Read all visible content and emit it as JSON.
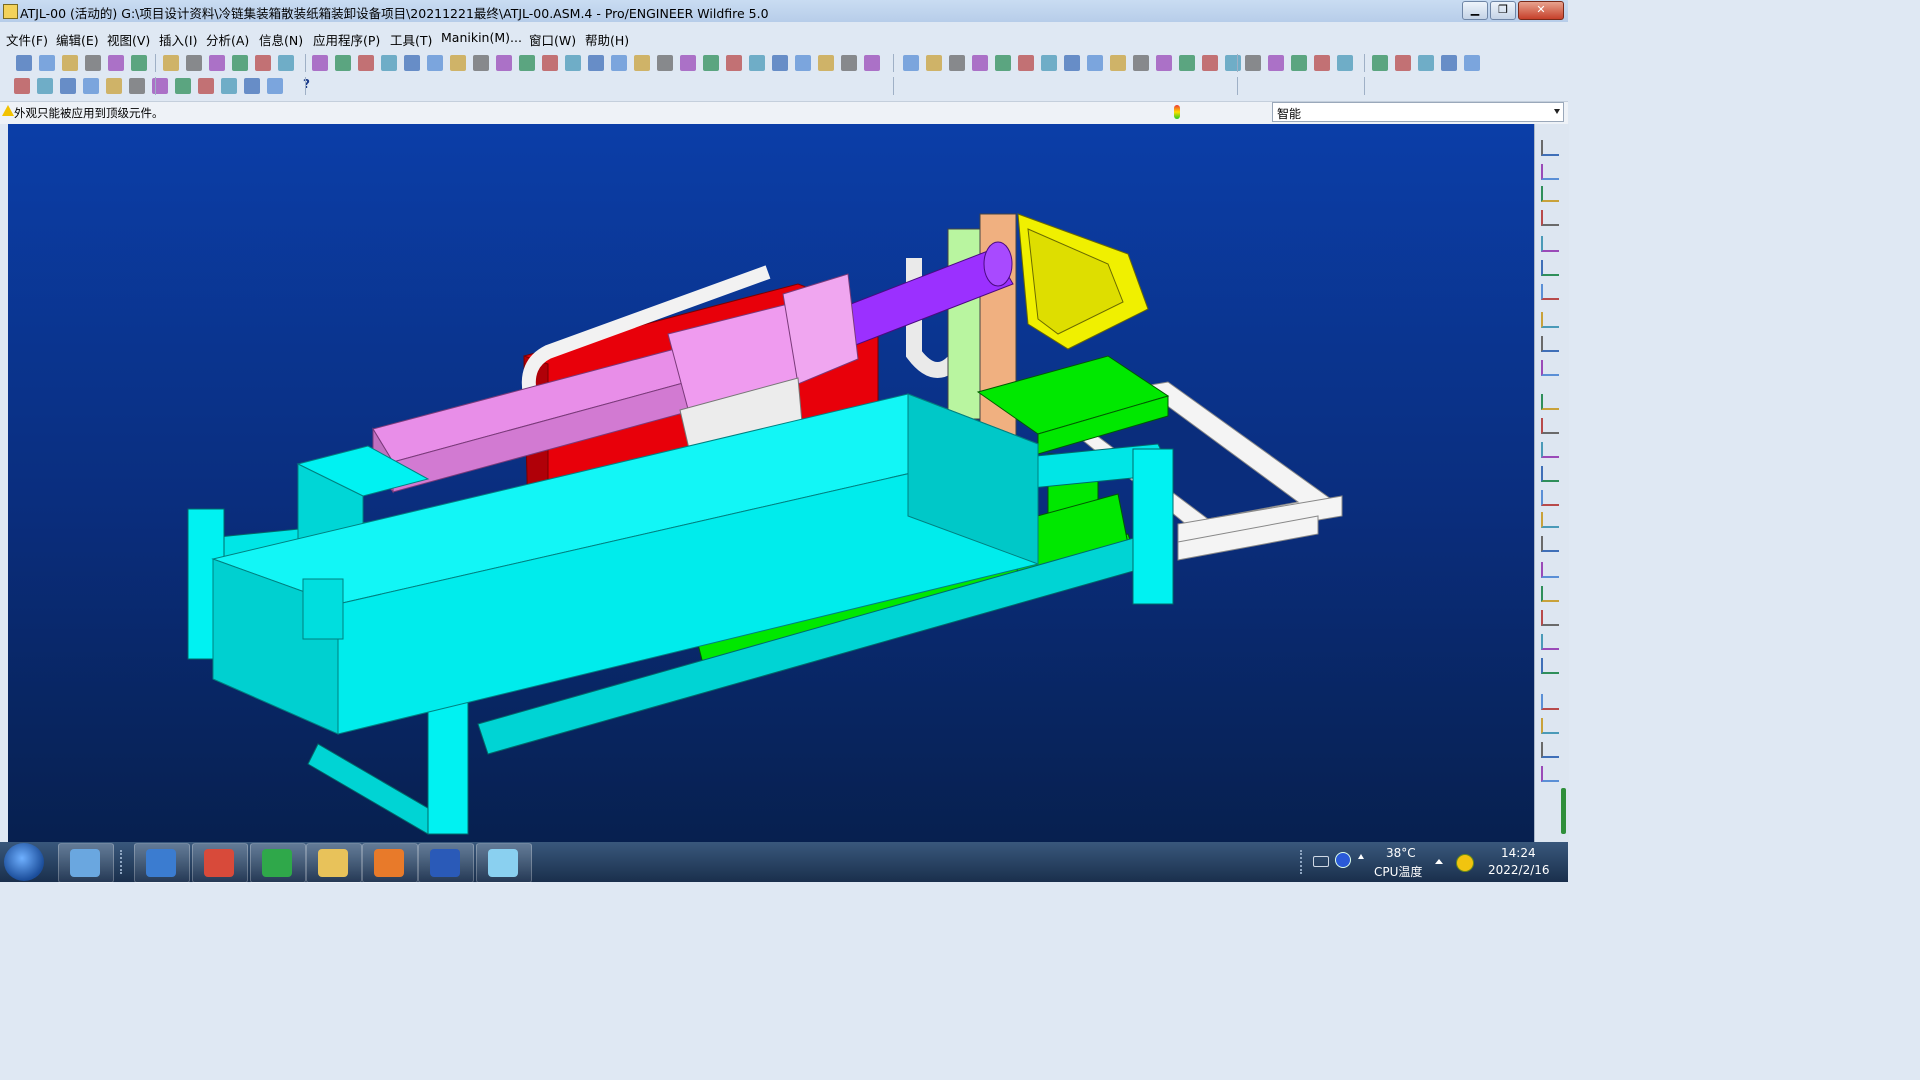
{
  "window": {
    "title": "ATJL-00 (活动的) G:\\项目设计资料\\冷链集装箱散装纸箱装卸设备项目\\20211221最终\\ATJL-00.ASM.4 - Pro/ENGINEER Wildfire 5.0",
    "controls": {
      "minimize": "▁",
      "maximize": "❐",
      "close": "✕"
    }
  },
  "menu": [
    "文件(F)",
    "编辑(E)",
    "视图(V)",
    "插入(I)",
    "分析(A)",
    "信息(N)",
    "应用程序(P)",
    "工具(T)",
    "Manikin(M)...",
    "窗口(W)",
    "帮助(H)"
  ],
  "message_bar": {
    "text": "外观只能被应用到顶级元件。",
    "filter_label": "智能"
  },
  "toolbar": {
    "help_icon_label": "?"
  },
  "taskbar": {
    "apps": [
      "hp-icon",
      "network-icon",
      "chrome-icon",
      "ie-icon",
      "explorer-icon",
      "pdf-icon",
      "word-icon",
      "proe-icon"
    ],
    "temperature": "38°C",
    "cpu_label": "CPU温度",
    "time": "14:24",
    "date": "2022/2/16"
  },
  "colors": {
    "viewport_top": "#0b3ea8",
    "viewport_bottom": "#07204f",
    "frame_cyan": "#00f2f2",
    "arm_purple": "#9b30ff",
    "arm_pink": "#e88ee8",
    "body_red": "#e8000a",
    "conveyor_green": "#00e800",
    "gripper_yellow": "#f0f000"
  }
}
